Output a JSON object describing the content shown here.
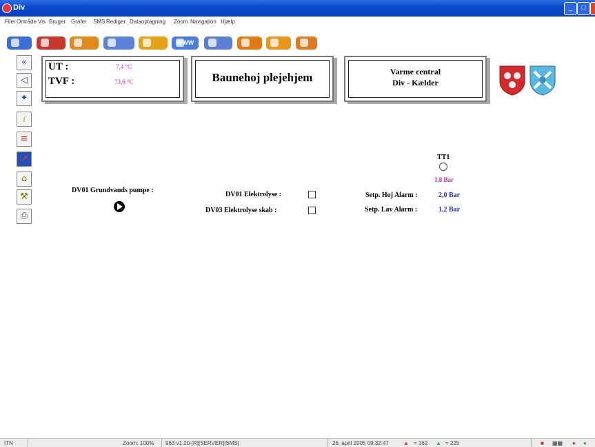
{
  "window": {
    "title": "Div",
    "min_symbol": "_",
    "max_symbol": "□",
    "close_symbol": "x"
  },
  "menu": [
    "Filer",
    "Område",
    "Vis",
    "Bruger",
    "Grafer",
    "SMS",
    "Rediger",
    "Dataoptagning",
    "Zoom",
    "Navigation",
    "Hjælp"
  ],
  "toolbar": {
    "buttons": [
      {
        "name": "overview-button",
        "color": "#3c6fd6"
      },
      {
        "name": "plant-button",
        "color": "#c8372b"
      },
      {
        "name": "info-button",
        "color": "#e08a1c"
      },
      {
        "name": "network-button",
        "color": "#5b84d9"
      },
      {
        "name": "folder-button",
        "color": "#e3a21a"
      },
      {
        "name": "www-button",
        "color": "#4a7de0",
        "label": "WWW"
      },
      {
        "name": "monitor-button",
        "color": "#5c7fd2"
      },
      {
        "name": "alarm-button",
        "color": "#e07b14"
      },
      {
        "name": "chart-button",
        "color": "#e8961c"
      },
      {
        "name": "sms-button",
        "color": "#e07a1c"
      }
    ]
  },
  "sidebar": {
    "items": [
      {
        "name": "back-double-button",
        "icon": "«"
      },
      {
        "name": "back-button",
        "icon": "◁"
      },
      {
        "name": "network-nav-button",
        "icon": "✦"
      },
      {
        "name": "info-nav-button",
        "icon": "i"
      },
      {
        "name": "notes-nav-button",
        "icon": "≡"
      },
      {
        "name": "graph-nav-button",
        "icon": "↗"
      },
      {
        "name": "lock-nav-button",
        "icon": "⌂"
      },
      {
        "name": "tools-nav-button",
        "icon": "⚒"
      },
      {
        "name": "print-nav-button",
        "icon": "⎙"
      }
    ]
  },
  "temps": {
    "ut_label": "UT :",
    "ut_value": "7,4 °C",
    "tvf_label": "TVF :",
    "tvf_value": "73,6 °C",
    "ut_color": "#cc22bb",
    "tvf_color": "#cc22bb"
  },
  "site_title": "Baunehoj plejehjem",
  "location": {
    "line1": "Varme central",
    "line2": "Div - Kælder"
  },
  "tt1": {
    "label": "TT1",
    "value": "1,8 Bar",
    "value_color": "#b22ab5"
  },
  "setpoints": {
    "high_label": "Setp. Hoj Alarm :",
    "high_value": "2,0 Bar",
    "low_label": "Setp. Lav Alarm :",
    "low_value": "1,2 Bar",
    "value_color": "#2233aa"
  },
  "pump": {
    "label": "DV01 Grundvands pumpe :"
  },
  "checks": {
    "dv01_label": "DV01 Elektrolyse :",
    "dv03_label": "DV03 Elektrolyse skab :"
  },
  "status": {
    "mode": "ITN",
    "zoom": "Zoom: 100%",
    "version": "963 v1.20-[R][SERVER][SMS]",
    "datetime": "26. april 2005 09:32:47",
    "count1": "= 162",
    "count2": "= 225"
  }
}
